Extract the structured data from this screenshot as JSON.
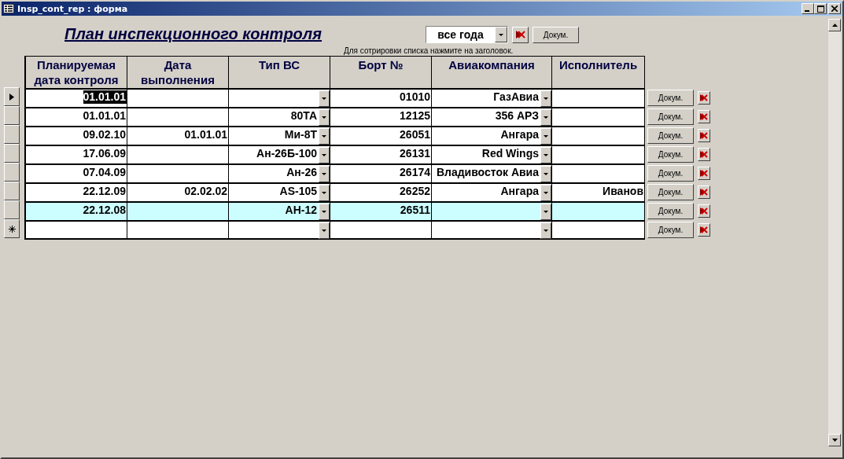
{
  "window": {
    "title": "Insp_cont_rep : форма"
  },
  "form_title": "План инспекционного контроля",
  "year_filter": {
    "value": "все года"
  },
  "top_doc_button": "Докум.",
  "sort_hint": "Для сотрировки списка нажмите на заголовок.",
  "table": {
    "columns": [
      "Планируемая дата контроля",
      "Дата выполнения",
      "Тип ВС",
      "Борт №",
      "Авиакомпания",
      "Исполнитель"
    ],
    "rows": [
      {
        "current": true,
        "new_record": false,
        "highlighted": false,
        "first_cell_selected": true,
        "cells": [
          "01.01.01",
          "",
          "",
          "01010",
          "ГазАвиа",
          ""
        ],
        "doc_button": "Докум."
      },
      {
        "current": false,
        "new_record": false,
        "highlighted": false,
        "first_cell_selected": false,
        "cells": [
          "01.01.01",
          "",
          "80ТА",
          "12125",
          "356 АРЗ",
          ""
        ],
        "doc_button": "Докум."
      },
      {
        "current": false,
        "new_record": false,
        "highlighted": false,
        "first_cell_selected": false,
        "cells": [
          "09.02.10",
          "01.01.01",
          "Ми-8Т",
          "26051",
          "Ангара",
          ""
        ],
        "doc_button": "Докум."
      },
      {
        "current": false,
        "new_record": false,
        "highlighted": false,
        "first_cell_selected": false,
        "cells": [
          "17.06.09",
          "",
          "Ан-26Б-100",
          "26131",
          "Red Wings",
          ""
        ],
        "doc_button": "Докум."
      },
      {
        "current": false,
        "new_record": false,
        "highlighted": false,
        "first_cell_selected": false,
        "cells": [
          "07.04.09",
          "",
          "Ан-26",
          "26174",
          "Владивосток Авиа",
          ""
        ],
        "doc_button": "Докум."
      },
      {
        "current": false,
        "new_record": false,
        "highlighted": false,
        "first_cell_selected": false,
        "cells": [
          "22.12.09",
          "02.02.02",
          "AS-105",
          "26252",
          "Ангара",
          "Иванов"
        ],
        "doc_button": "Докум."
      },
      {
        "current": false,
        "new_record": false,
        "highlighted": true,
        "first_cell_selected": false,
        "cells": [
          "22.12.08",
          "",
          "АН-12",
          "26511",
          "",
          ""
        ],
        "doc_button": "Докум."
      },
      {
        "current": false,
        "new_record": true,
        "highlighted": false,
        "first_cell_selected": false,
        "cells": [
          "",
          "",
          "",
          "",
          "",
          ""
        ],
        "doc_button": "Докум."
      }
    ]
  }
}
